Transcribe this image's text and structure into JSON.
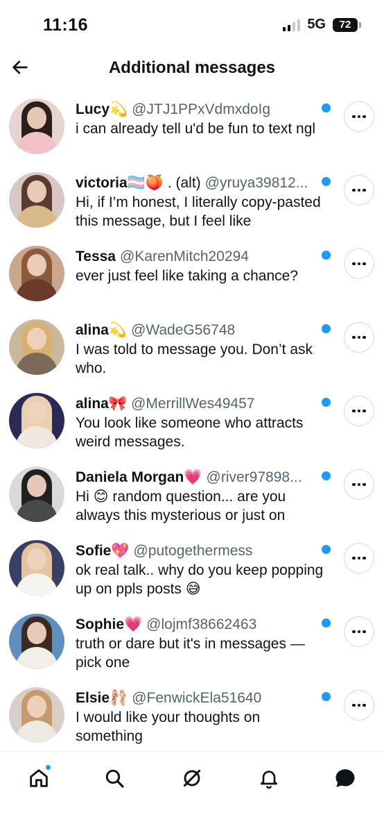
{
  "status": {
    "time": "11:16",
    "network": "5G",
    "battery": "72"
  },
  "header": {
    "title": "Additional messages",
    "back_icon": "arrow-left-icon"
  },
  "conversations": [
    {
      "name": "Lucy",
      "emoji": "💫",
      "handle": "@JTJ1PPxVdmxdoIg",
      "message": "i can already tell u'd be fun to text ngl",
      "unread": true,
      "avatar_colors": [
        "#e7d3cf",
        "#2a1f1c",
        "#f0c2c8"
      ]
    },
    {
      "name": "victoria",
      "emoji": "🏳️‍⚧️🍑 . (alt)",
      "handle": "@yruya39812...",
      "message": "Hi, if I’m honest, I literally copy-pasted this message, but I feel like",
      "unread": true,
      "avatar_colors": [
        "#d9c7c6",
        "#5a3b2e",
        "#d7b98a"
      ]
    },
    {
      "name": "Tessa",
      "emoji": "",
      "handle": "@KarenMitch20294",
      "message": "ever just feel like taking a chance?",
      "unread": true,
      "avatar_colors": [
        "#caa68d",
        "#8a5a3a",
        "#6b3a2b"
      ]
    },
    {
      "name": "alina",
      "emoji": "💫",
      "handle": "@WadeG56748",
      "message": "I was told to message you. Don’t ask who.",
      "unread": true,
      "avatar_colors": [
        "#c9b89e",
        "#d8b070",
        "#7b6a5a"
      ]
    },
    {
      "name": "alina",
      "emoji": "🎀",
      "handle": "@MerrillWes49457",
      "message": "You look like someone who attracts weird messages.",
      "unread": true,
      "avatar_colors": [
        "#2b2a55",
        "#e8d0b0",
        "#f2e6e0"
      ]
    },
    {
      "name": "Daniela Morgan",
      "emoji": "💗",
      "handle": "@river97898...",
      "message": "Hi 😊 random question... are you always this mysterious or just on",
      "unread": true,
      "avatar_colors": [
        "#d9d9d9",
        "#202020",
        "#4a4a4a"
      ]
    },
    {
      "name": "Sofie",
      "emoji": "💖",
      "handle": "@putogethermess",
      "message": "ok real talk.. why do you keep popping up on ppls posts 😅",
      "unread": true,
      "avatar_colors": [
        "#3a3f66",
        "#e6c4a0",
        "#f5f5f0"
      ]
    },
    {
      "name": "Sophie",
      "emoji": "💗",
      "handle": "@lojmf38662463",
      "message": "truth or dare but it's in messages — pick one",
      "unread": true,
      "avatar_colors": [
        "#5f8fbf",
        "#3a2a22",
        "#f2efe9"
      ]
    },
    {
      "name": "Elsie",
      "emoji": "🩰",
      "handle": "@FenwickEla51640",
      "message": "I would like your thoughts on something",
      "unread": true,
      "avatar_colors": [
        "#d8cfc8",
        "#c69a6e",
        "#efe9e4"
      ]
    }
  ],
  "bottom_nav": [
    {
      "label": "Home",
      "icon": "home-icon",
      "badge": true
    },
    {
      "label": "Search",
      "icon": "search-icon",
      "badge": false
    },
    {
      "label": "Grok",
      "icon": "grok-icon",
      "badge": false
    },
    {
      "label": "Notifications",
      "icon": "bell-icon",
      "badge": false
    },
    {
      "label": "Messages",
      "icon": "messages-icon",
      "badge": false
    }
  ],
  "colors": {
    "accent": "#1d9bf0",
    "text": "#0f1419",
    "secondary": "#536471",
    "border": "#cfd9de"
  }
}
